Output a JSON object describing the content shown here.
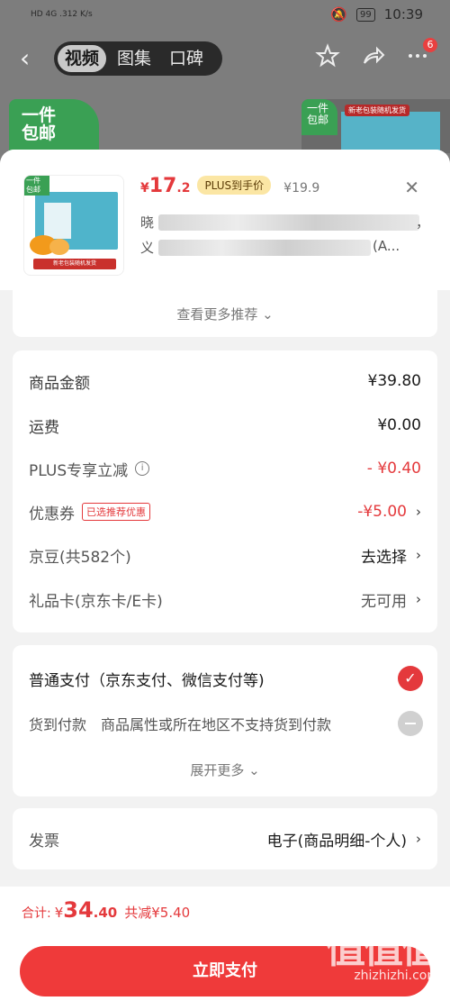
{
  "status_bar": {
    "left": "HD 4G .312 K/s",
    "time": "10:39",
    "battery": "99"
  },
  "nav": {
    "tabs": [
      "视频",
      "图集",
      "口碑"
    ],
    "active_tab": 0,
    "badge_count": "6"
  },
  "promo": {
    "left_text": "一件\n包邮",
    "right_tag": "新老包装随机发货",
    "right_mini": "一件\n包邮"
  },
  "product": {
    "thumb_tag": "一件\n包邮",
    "thumb_label": "新老包装随机发货",
    "currency": "¥",
    "price_int": "17",
    "price_dec": ".2",
    "plus_label": "PLUS到手价",
    "old_price": "¥19.9",
    "title_line1_start": "晓",
    "title_line1_end": "，",
    "title_line2_start": "义",
    "title_line2_end": "(A..."
  },
  "more_recommend": "查看更多推荐 ⌄",
  "amounts": [
    {
      "label": "商品金额",
      "value": "¥39.80"
    },
    {
      "label": "运费",
      "value": "¥0.00"
    },
    {
      "label": "PLUS专享立减",
      "value": "- ¥0.40"
    },
    {
      "label": "优惠券",
      "tag": "已选推荐优惠",
      "value": "-¥5.00"
    },
    {
      "label": "京豆(共582个)",
      "value": "去选择"
    },
    {
      "label": "礼品卡(京东卡/E卡)",
      "value": "无可用"
    }
  ],
  "payment": {
    "normal": "普通支付（京东支付、微信支付等)",
    "cod_label": "货到付款",
    "cod_desc": "商品属性或所在地区不支持货到付款",
    "expand": "展开更多 ⌄"
  },
  "invoice": {
    "label": "发票",
    "value": "电子(商品明细-个人)"
  },
  "footer": {
    "total_label": "合计:",
    "currency": "¥",
    "total_int": "34",
    "total_dec": ".40",
    "saved": "共减¥5.40",
    "pay_button": "立即支付"
  },
  "watermark": {
    "big": "值值值",
    "small": "zhizhizhi.com"
  },
  "colors": {
    "accent": "#e4393c",
    "button": "#ef3a3a",
    "plus_tag": "#fbe6a4"
  }
}
